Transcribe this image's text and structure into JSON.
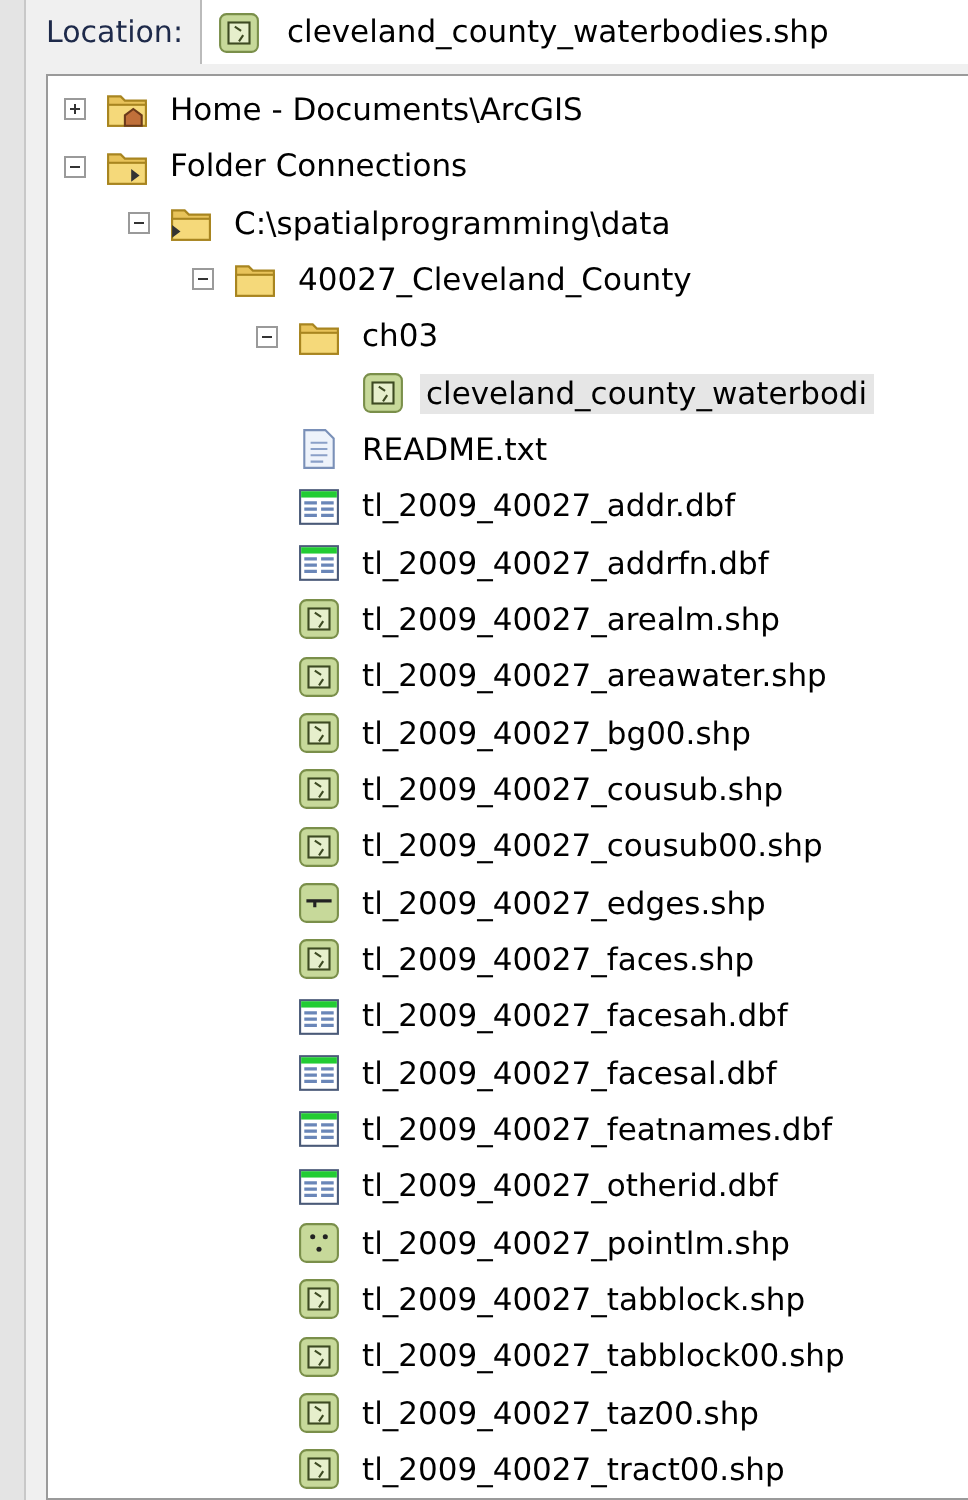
{
  "location": {
    "label": "Location:",
    "value": "cleveland_county_waterbodies.shp",
    "kind": "polygon"
  },
  "tree": [
    {
      "name": "Home - Documents\\ArcGIS",
      "kind": "home-folder",
      "expanded": false,
      "selected": false
    },
    {
      "name": "Folder Connections",
      "kind": "connections",
      "expanded": true,
      "selected": false,
      "children": [
        {
          "name": "C:\\spatialprogramming\\data",
          "kind": "folder-connection",
          "expanded": true,
          "selected": false,
          "children": [
            {
              "name": "40027_Cleveland_County",
              "kind": "folder",
              "expanded": true,
              "selected": false,
              "children": [
                {
                  "name": "ch03",
                  "kind": "folder",
                  "expanded": true,
                  "selected": false,
                  "children": [
                    {
                      "name": "cleveland_county_waterbodi",
                      "kind": "polygon",
                      "selected": true
                    }
                  ]
                },
                {
                  "name": "README.txt",
                  "kind": "text",
                  "selected": false
                },
                {
                  "name": "tl_2009_40027_addr.dbf",
                  "kind": "table",
                  "selected": false
                },
                {
                  "name": "tl_2009_40027_addrfn.dbf",
                  "kind": "table",
                  "selected": false
                },
                {
                  "name": "tl_2009_40027_arealm.shp",
                  "kind": "polygon",
                  "selected": false
                },
                {
                  "name": "tl_2009_40027_areawater.shp",
                  "kind": "polygon",
                  "selected": false
                },
                {
                  "name": "tl_2009_40027_bg00.shp",
                  "kind": "polygon",
                  "selected": false
                },
                {
                  "name": "tl_2009_40027_cousub.shp",
                  "kind": "polygon",
                  "selected": false
                },
                {
                  "name": "tl_2009_40027_cousub00.shp",
                  "kind": "polygon",
                  "selected": false
                },
                {
                  "name": "tl_2009_40027_edges.shp",
                  "kind": "line",
                  "selected": false
                },
                {
                  "name": "tl_2009_40027_faces.shp",
                  "kind": "polygon",
                  "selected": false
                },
                {
                  "name": "tl_2009_40027_facesah.dbf",
                  "kind": "table",
                  "selected": false
                },
                {
                  "name": "tl_2009_40027_facesal.dbf",
                  "kind": "table",
                  "selected": false
                },
                {
                  "name": "tl_2009_40027_featnames.dbf",
                  "kind": "table",
                  "selected": false
                },
                {
                  "name": "tl_2009_40027_otherid.dbf",
                  "kind": "table",
                  "selected": false
                },
                {
                  "name": "tl_2009_40027_pointlm.shp",
                  "kind": "point",
                  "selected": false
                },
                {
                  "name": "tl_2009_40027_tabblock.shp",
                  "kind": "polygon",
                  "selected": false
                },
                {
                  "name": "tl_2009_40027_tabblock00.shp",
                  "kind": "polygon",
                  "selected": false
                },
                {
                  "name": "tl_2009_40027_taz00.shp",
                  "kind": "polygon",
                  "selected": false
                },
                {
                  "name": "tl_2009_40027_tract00.shp",
                  "kind": "polygon",
                  "selected": false
                }
              ]
            }
          ]
        }
      ]
    }
  ]
}
